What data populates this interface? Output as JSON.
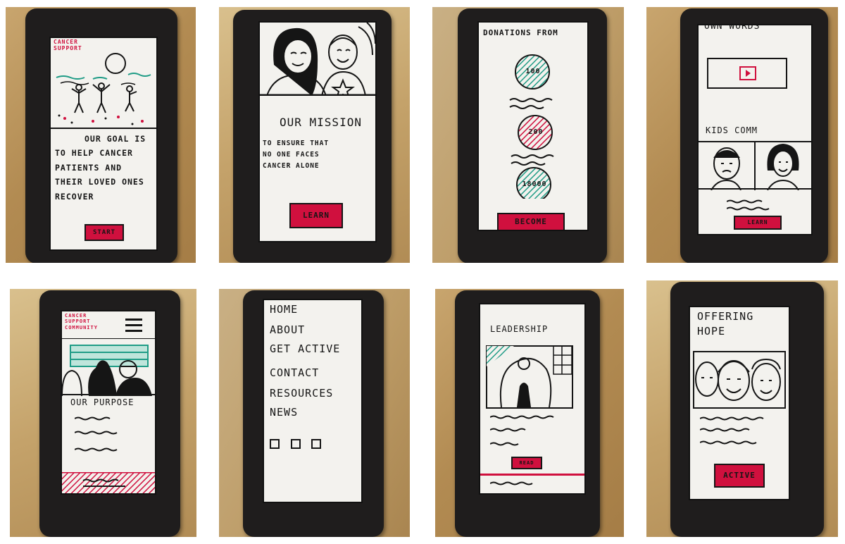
{
  "screens": [
    {
      "brand": "CANCER SUPPORT",
      "lines": [
        "OUR GOAL IS",
        "TO HELP CANCER",
        "PATIENTS AND",
        "THEIR LOVED ONES",
        "RECOVER"
      ],
      "button": "START"
    },
    {
      "heading": "OUR MISSION",
      "lines": [
        "TO ENSURE THAT",
        "NO ONE FACES",
        "CANCER ALONE"
      ],
      "button": "LEARN"
    },
    {
      "heading": "DONATIONS FROM",
      "circles": [
        "100",
        "200",
        "18000"
      ],
      "button": "BECOME"
    },
    {
      "heading": "OWN WORDS",
      "subheading": "KIDS COMM",
      "button": "LEARN"
    },
    {
      "brand": "CANCER SUPPORT COMMUNITY",
      "heading": "OUR PURPOSE"
    },
    {
      "menu": [
        "HOME",
        "ABOUT",
        "GET ACTIVE",
        "CONTACT",
        "RESOURCES",
        "NEWS"
      ]
    },
    {
      "heading": "LEADERSHIP",
      "button": "READ"
    },
    {
      "heading_line1": "OFFERING",
      "heading_line2": "HOPE",
      "button": "ACTIVE"
    }
  ],
  "colors": {
    "accent": "#d0103e",
    "teal": "#1f9c86",
    "frame": "#1f1d1d",
    "paper": "#f3f2ee"
  }
}
